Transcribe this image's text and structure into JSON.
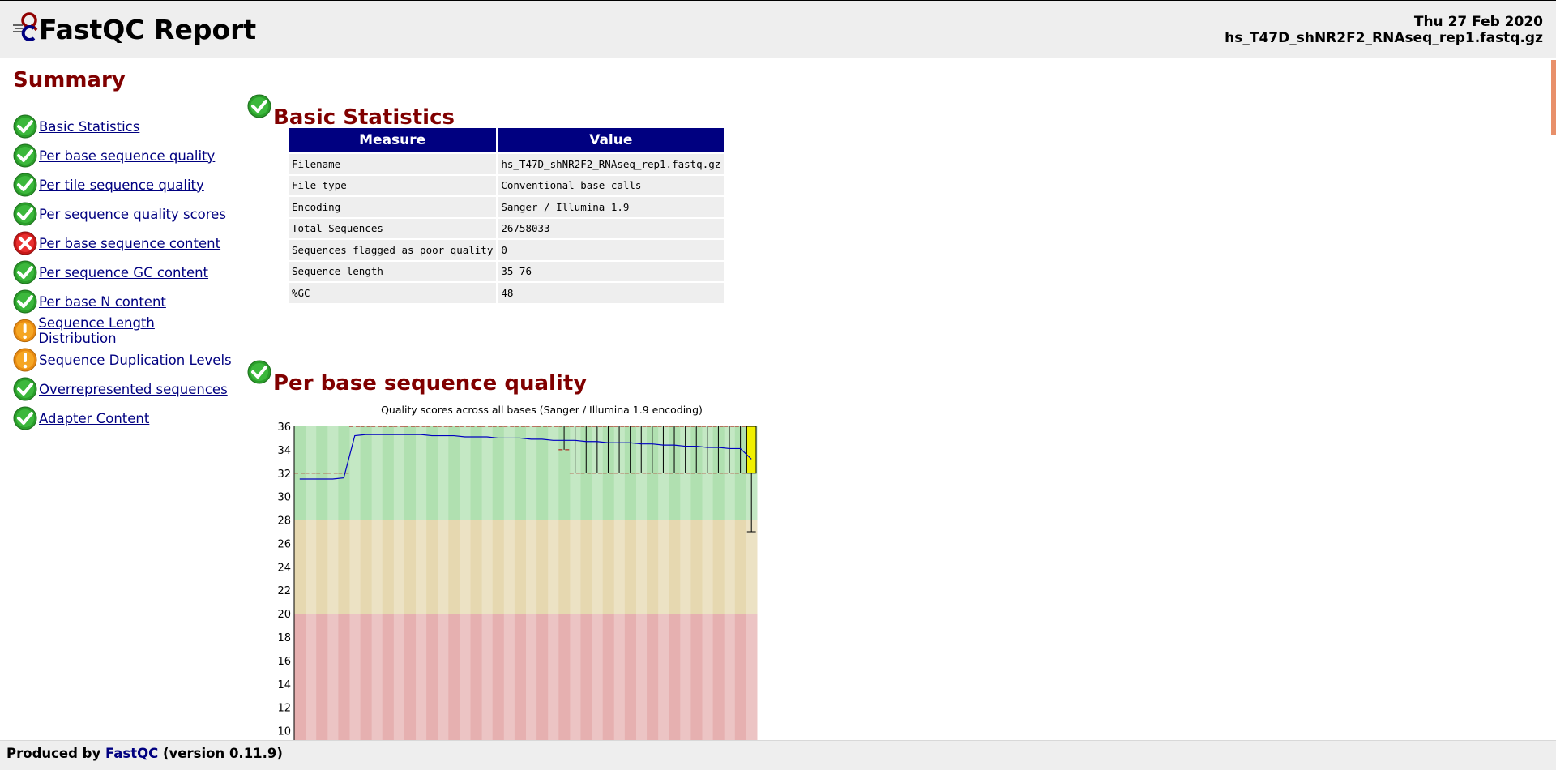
{
  "header": {
    "title": "FastQC Report",
    "date": "Thu 27 Feb 2020",
    "filename": "hs_T47D_shNR2F2_RNAseq_rep1.fastq.gz"
  },
  "summary": {
    "title": "Summary",
    "items": [
      {
        "label": "Basic Statistics",
        "status": "pass"
      },
      {
        "label": "Per base sequence quality",
        "status": "pass"
      },
      {
        "label": "Per tile sequence quality",
        "status": "pass"
      },
      {
        "label": "Per sequence quality scores",
        "status": "pass"
      },
      {
        "label": "Per base sequence content",
        "status": "fail"
      },
      {
        "label": "Per sequence GC content",
        "status": "pass"
      },
      {
        "label": "Per base N content",
        "status": "pass"
      },
      {
        "label": "Sequence Length Distribution",
        "status": "warn"
      },
      {
        "label": "Sequence Duplication Levels",
        "status": "warn"
      },
      {
        "label": "Overrepresented sequences",
        "status": "pass"
      },
      {
        "label": "Adapter Content",
        "status": "pass"
      }
    ]
  },
  "basic_stats": {
    "heading": "Basic Statistics",
    "columns": [
      "Measure",
      "Value"
    ],
    "rows": [
      [
        "Filename",
        "hs_T47D_shNR2F2_RNAseq_rep1.fastq.gz"
      ],
      [
        "File type",
        "Conventional base calls"
      ],
      [
        "Encoding",
        "Sanger / Illumina 1.9"
      ],
      [
        "Total Sequences",
        "26758033"
      ],
      [
        "Sequences flagged as poor quality",
        "0"
      ],
      [
        "Sequence length",
        "35-76"
      ],
      [
        "%GC",
        "48"
      ]
    ]
  },
  "quality": {
    "heading": "Per base sequence quality"
  },
  "chart_data": {
    "type": "box",
    "title": "Quality scores across all bases (Sanger / Illumina 1.9 encoding)",
    "ylim": [
      9,
      36
    ],
    "yticks": [
      10,
      12,
      14,
      16,
      18,
      20,
      22,
      24,
      26,
      28,
      30,
      32,
      34,
      36
    ],
    "zones": [
      {
        "from": 28,
        "to": 36,
        "color": "#b0e0b0",
        "name": "good"
      },
      {
        "from": 20,
        "to": 28,
        "color": "#e6d8b0",
        "name": "reasonable"
      },
      {
        "from": 0,
        "to": 20,
        "color": "#e6b0b0",
        "name": "poor"
      }
    ],
    "x_count": 42,
    "mean": [
      31.5,
      31.5,
      31.5,
      31.5,
      31.6,
      35.2,
      35.3,
      35.3,
      35.3,
      35.3,
      35.3,
      35.3,
      35.2,
      35.2,
      35.2,
      35.1,
      35.1,
      35.1,
      35.0,
      35.0,
      35.0,
      34.9,
      34.9,
      34.8,
      34.8,
      34.8,
      34.7,
      34.7,
      34.6,
      34.6,
      34.6,
      34.5,
      34.5,
      34.4,
      34.4,
      34.3,
      34.3,
      34.2,
      34.2,
      34.1,
      34.1,
      33.2
    ],
    "box_q1": [
      32,
      32,
      32,
      32,
      32,
      36,
      36,
      36,
      36,
      36,
      36,
      36,
      36,
      36,
      36,
      36,
      36,
      36,
      36,
      36,
      36,
      36,
      36,
      36,
      34,
      32,
      32,
      32,
      32,
      32,
      32,
      32,
      32,
      32,
      32,
      32,
      32,
      32,
      32,
      32,
      32,
      32
    ],
    "box_q3": [
      32,
      32,
      32,
      32,
      32,
      36,
      36,
      36,
      36,
      36,
      36,
      36,
      36,
      36,
      36,
      36,
      36,
      36,
      36,
      36,
      36,
      36,
      36,
      36,
      36,
      36,
      36,
      36,
      36,
      36,
      36,
      36,
      36,
      36,
      36,
      36,
      36,
      36,
      36,
      36,
      36,
      36
    ],
    "whisker_lo": [
      32,
      32,
      32,
      32,
      32,
      36,
      36,
      36,
      36,
      36,
      36,
      36,
      36,
      36,
      36,
      36,
      36,
      36,
      36,
      36,
      36,
      36,
      36,
      36,
      34,
      32,
      32,
      32,
      32,
      32,
      32,
      32,
      32,
      32,
      32,
      32,
      32,
      32,
      32,
      32,
      32,
      27
    ],
    "highlight_last": true
  },
  "footer": {
    "prefix": "Produced by",
    "link": "FastQC",
    "suffix": "(version 0.11.9)"
  }
}
